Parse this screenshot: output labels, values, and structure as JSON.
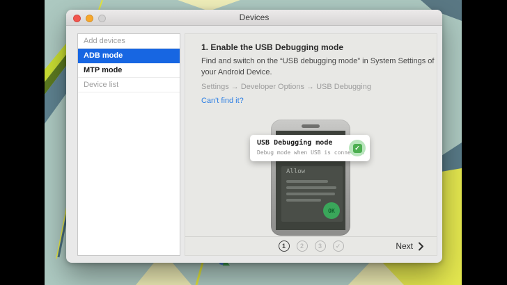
{
  "window": {
    "title": "Devices"
  },
  "sidebar": {
    "items": [
      {
        "label": "Add devices"
      },
      {
        "label": "ADB mode"
      },
      {
        "label": "MTP mode"
      },
      {
        "label": "Device list"
      }
    ]
  },
  "content": {
    "step_heading": "1. Enable the USB Debugging mode",
    "instruction": "Find and switch on the “USB debugging mode” in System Settings of your Android Device.",
    "settings_path": "Settings → Developer Options → USB Debugging",
    "help_link": "Can't find it?"
  },
  "illustration": {
    "tooltip_title": "USB Debugging mode",
    "tooltip_subtitle": "Debug mode when USB is connected",
    "check_glyph": "✓",
    "phone_dialog_title": "Allow",
    "phone_ok_label": "OK"
  },
  "footer": {
    "steps": [
      "1",
      "2",
      "3"
    ],
    "step_done_glyph": "✓",
    "next_label": "Next"
  },
  "colors": {
    "selection_blue": "#1766e2",
    "link_blue": "#2f80e4",
    "success_green": "#4caf50",
    "ok_green": "#3aa65a",
    "wallpaper_teal": "#adc9c1",
    "titlebar_gray": "#dedcdc"
  }
}
